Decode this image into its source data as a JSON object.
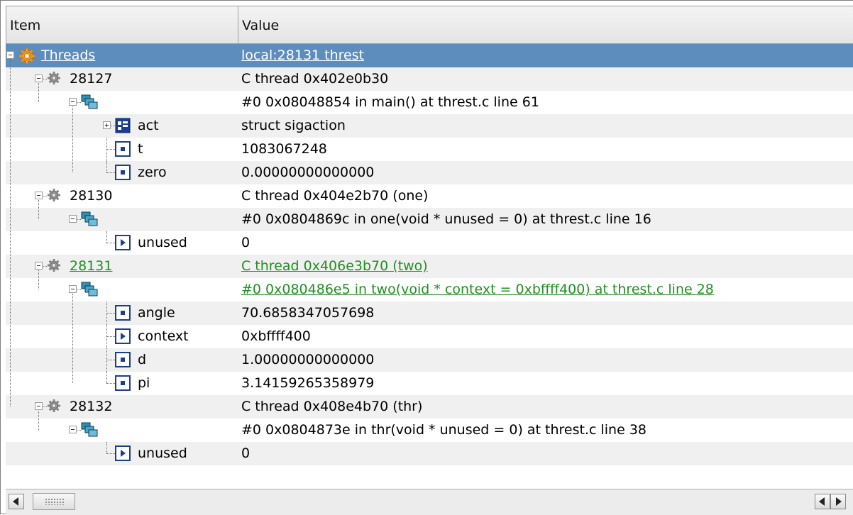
{
  "columns": {
    "item": "Item",
    "value": "Value"
  },
  "rows": [
    {
      "name": "Threads",
      "value": "local:28131 threst",
      "icon": "gear-large-icon",
      "state": "selected"
    },
    {
      "name": "28127",
      "value": "C thread 0x402e0b30",
      "icon": "gear-icon"
    },
    {
      "name": "",
      "value": "#0 0x08048854 in main() at threst.c line 61",
      "icon": "stack-frame-icon"
    },
    {
      "name": "act",
      "value": "struct sigaction",
      "icon": "struct-icon"
    },
    {
      "name": "t",
      "value": "1083067248",
      "icon": "variable-icon"
    },
    {
      "name": "zero",
      "value": "0.00000000000000",
      "icon": "variable-icon"
    },
    {
      "name": "28130",
      "value": "C thread 0x404e2b70 (one)",
      "icon": "gear-icon"
    },
    {
      "name": "",
      "value": "#0 0x0804869c in one(void * unused = 0) at threst.c line 16",
      "icon": "stack-frame-icon"
    },
    {
      "name": "unused",
      "value": "0",
      "icon": "pointer-icon"
    },
    {
      "name": "28131",
      "value": "C thread 0x406e3b70 (two)",
      "icon": "gear-icon",
      "state": "highlighted"
    },
    {
      "name": "",
      "value": "#0 0x080486e5 in two(void * context = 0xbffff400) at threst.c line 28",
      "icon": "stack-frame-icon",
      "state": "highlighted"
    },
    {
      "name": "angle",
      "value": "70.6858347057698",
      "icon": "variable-icon"
    },
    {
      "name": "context",
      "value": "0xbffff400",
      "icon": "pointer-icon"
    },
    {
      "name": "d",
      "value": "1.00000000000000",
      "icon": "variable-icon"
    },
    {
      "name": "pi",
      "value": "3.14159265358979",
      "icon": "variable-icon"
    },
    {
      "name": "28132",
      "value": "C thread 0x408e4b70 (thr)",
      "icon": "gear-icon"
    },
    {
      "name": "",
      "value": "#0 0x0804873e in thr(void * unused = 0) at threst.c line 38",
      "icon": "stack-frame-icon"
    },
    {
      "name": "unused",
      "value": "0",
      "icon": "pointer-icon"
    }
  ],
  "colors": {
    "selection": "#5d8dbd",
    "highlight": "#219021",
    "alt_row": "#f0f0f0"
  },
  "scrollbar": {
    "left_arrow": "◀",
    "right_arrow": "▶",
    "left_icon": "arrow-left-icon",
    "right_icon": "arrow-right-icon"
  }
}
